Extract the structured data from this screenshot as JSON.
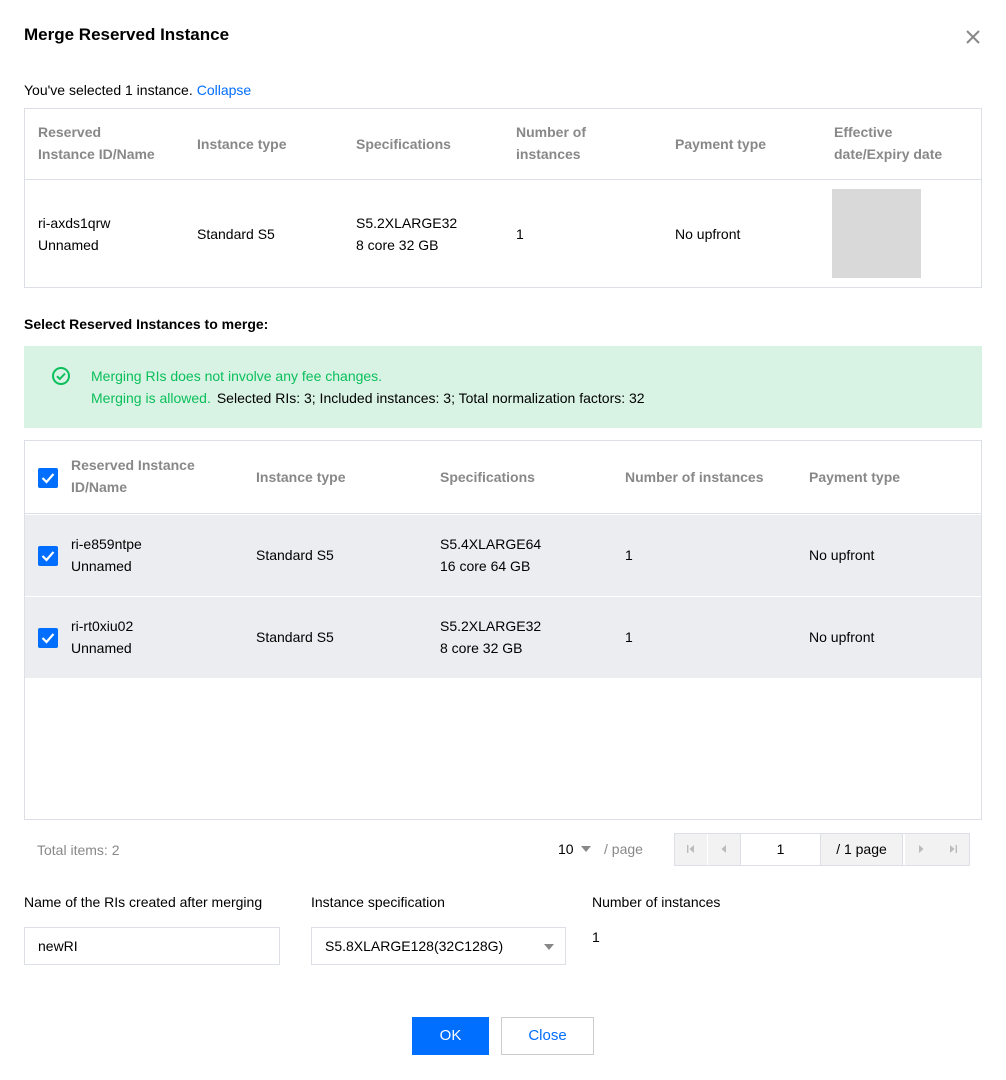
{
  "dialog": {
    "title": "Merge Reserved Instance"
  },
  "selected": {
    "text": "You've selected 1 instance.",
    "collapse_label": "Collapse"
  },
  "selected_table": {
    "headers": {
      "id_line1": "Reserved",
      "id_line2": "Instance ID/Name",
      "type": "Instance type",
      "spec": "Specifications",
      "count_line1": "Number of",
      "count_line2": "instances",
      "payment": "Payment type",
      "date_line1": "Effective",
      "date_line2": "date/Expiry date"
    },
    "rows": [
      {
        "id": "ri-axds1qrw",
        "name": "Unnamed",
        "type": "Standard S5",
        "spec_model": "S5.2XLARGE32",
        "spec_detail": "8 core 32 GB",
        "count": "1",
        "payment": "No upfront"
      }
    ]
  },
  "merge_section": {
    "title": "Select Reserved Instances to merge:"
  },
  "alert": {
    "line1": "Merging RIs does not involve any fee changes.",
    "allowed": "Merging is allowed.",
    "summary": "Selected RIs: 3; Included instances: 3; Total normalization factors: 32"
  },
  "merge_table": {
    "headers": {
      "id_line1": "Reserved Instance",
      "id_line2": "ID/Name",
      "type": "Instance type",
      "spec": "Specifications",
      "count": "Number of instances",
      "payment": "Payment type"
    },
    "rows": [
      {
        "id": "ri-e859ntpe",
        "name": "Unnamed",
        "type": "Standard S5",
        "spec_model": "S5.4XLARGE64",
        "spec_detail": "16 core 64 GB",
        "count": "1",
        "payment": "No upfront"
      },
      {
        "id": "ri-rt0xiu02",
        "name": "Unnamed",
        "type": "Standard S5",
        "spec_model": "S5.2XLARGE32",
        "spec_detail": "8 core 32 GB",
        "count": "1",
        "payment": "No upfront"
      }
    ]
  },
  "pagination": {
    "total_label": "Total items:  2",
    "page_size": "10",
    "per_page": "/ page",
    "current_page": "1",
    "of_pages": "/ 1 page"
  },
  "form": {
    "name_label": "Name of the RIs created after merging",
    "name_value": "newRI",
    "spec_label": "Instance specification",
    "spec_value": "S5.8XLARGE128(32C128G)",
    "count_label": "Number of instances",
    "count_value": "1"
  },
  "buttons": {
    "ok": "OK",
    "close": "Close"
  },
  "colors": {
    "accent": "#006eff",
    "success": "#0abf5b",
    "alert_bg": "#d8f3e3",
    "row_bg": "#ebedf0"
  }
}
